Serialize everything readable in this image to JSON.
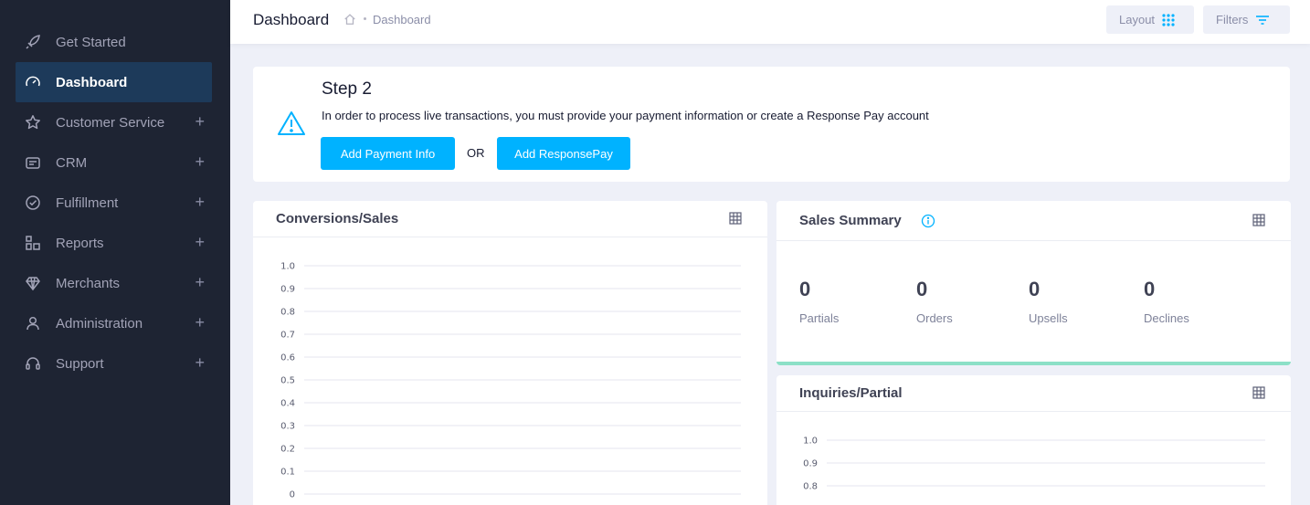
{
  "sidebar": {
    "items": [
      {
        "label": "Get Started",
        "icon": "rocket-icon",
        "has_plus": false,
        "active": false
      },
      {
        "label": "Dashboard",
        "icon": "speedometer-icon",
        "has_plus": false,
        "active": true
      },
      {
        "label": "Customer Service",
        "icon": "star-icon",
        "has_plus": true,
        "active": false
      },
      {
        "label": "CRM",
        "icon": "crm-icon",
        "has_plus": true,
        "active": false
      },
      {
        "label": "Fulfillment",
        "icon": "check-circle-icon",
        "has_plus": true,
        "active": false
      },
      {
        "label": "Reports",
        "icon": "reports-icon",
        "has_plus": true,
        "active": false
      },
      {
        "label": "Merchants",
        "icon": "diamond-icon",
        "has_plus": true,
        "active": false
      },
      {
        "label": "Administration",
        "icon": "user-icon",
        "has_plus": true,
        "active": false
      },
      {
        "label": "Support",
        "icon": "headset-icon",
        "has_plus": true,
        "active": false
      }
    ],
    "plus_glyph": "+"
  },
  "header": {
    "title": "Dashboard",
    "breadcrumb": "Dashboard",
    "layout_label": "Layout",
    "filters_label": "Filters"
  },
  "step": {
    "title": "Step 2",
    "message": "In order to process live transactions, you must provide your payment information or create a Response Pay account",
    "add_payment_label": "Add Payment Info",
    "or_label": "OR",
    "add_responsepay_label": "Add ResponsePay"
  },
  "conversions": {
    "title": "Conversions/Sales"
  },
  "sales_summary": {
    "title": "Sales Summary",
    "stats": [
      {
        "value": "0",
        "label": "Partials"
      },
      {
        "value": "0",
        "label": "Orders"
      },
      {
        "value": "0",
        "label": "Upsells"
      },
      {
        "value": "0",
        "label": "Declines"
      }
    ]
  },
  "inquiries": {
    "title": "Inquiries/Partial"
  },
  "colors": {
    "sidebar_bg": "#1e2433",
    "active_bg": "#1d3a5a",
    "primary": "#00b2ff",
    "sales_bar": "#8ce0c7"
  },
  "chart_data": [
    {
      "type": "line",
      "x": [],
      "series": [],
      "y_ticks": [
        "1.0",
        "0.9",
        "0.8",
        "0.7",
        "0.6",
        "0.5",
        "0.4",
        "0.3",
        "0.2",
        "0.1",
        "0"
      ],
      "ylim": [
        0,
        1.0
      ],
      "grid": true
    },
    {
      "type": "line",
      "x": [],
      "series": [],
      "y_ticks": [
        "1.0",
        "0.9",
        "0.8"
      ],
      "ylim": [
        0.8,
        1.0
      ],
      "grid": true
    }
  ]
}
